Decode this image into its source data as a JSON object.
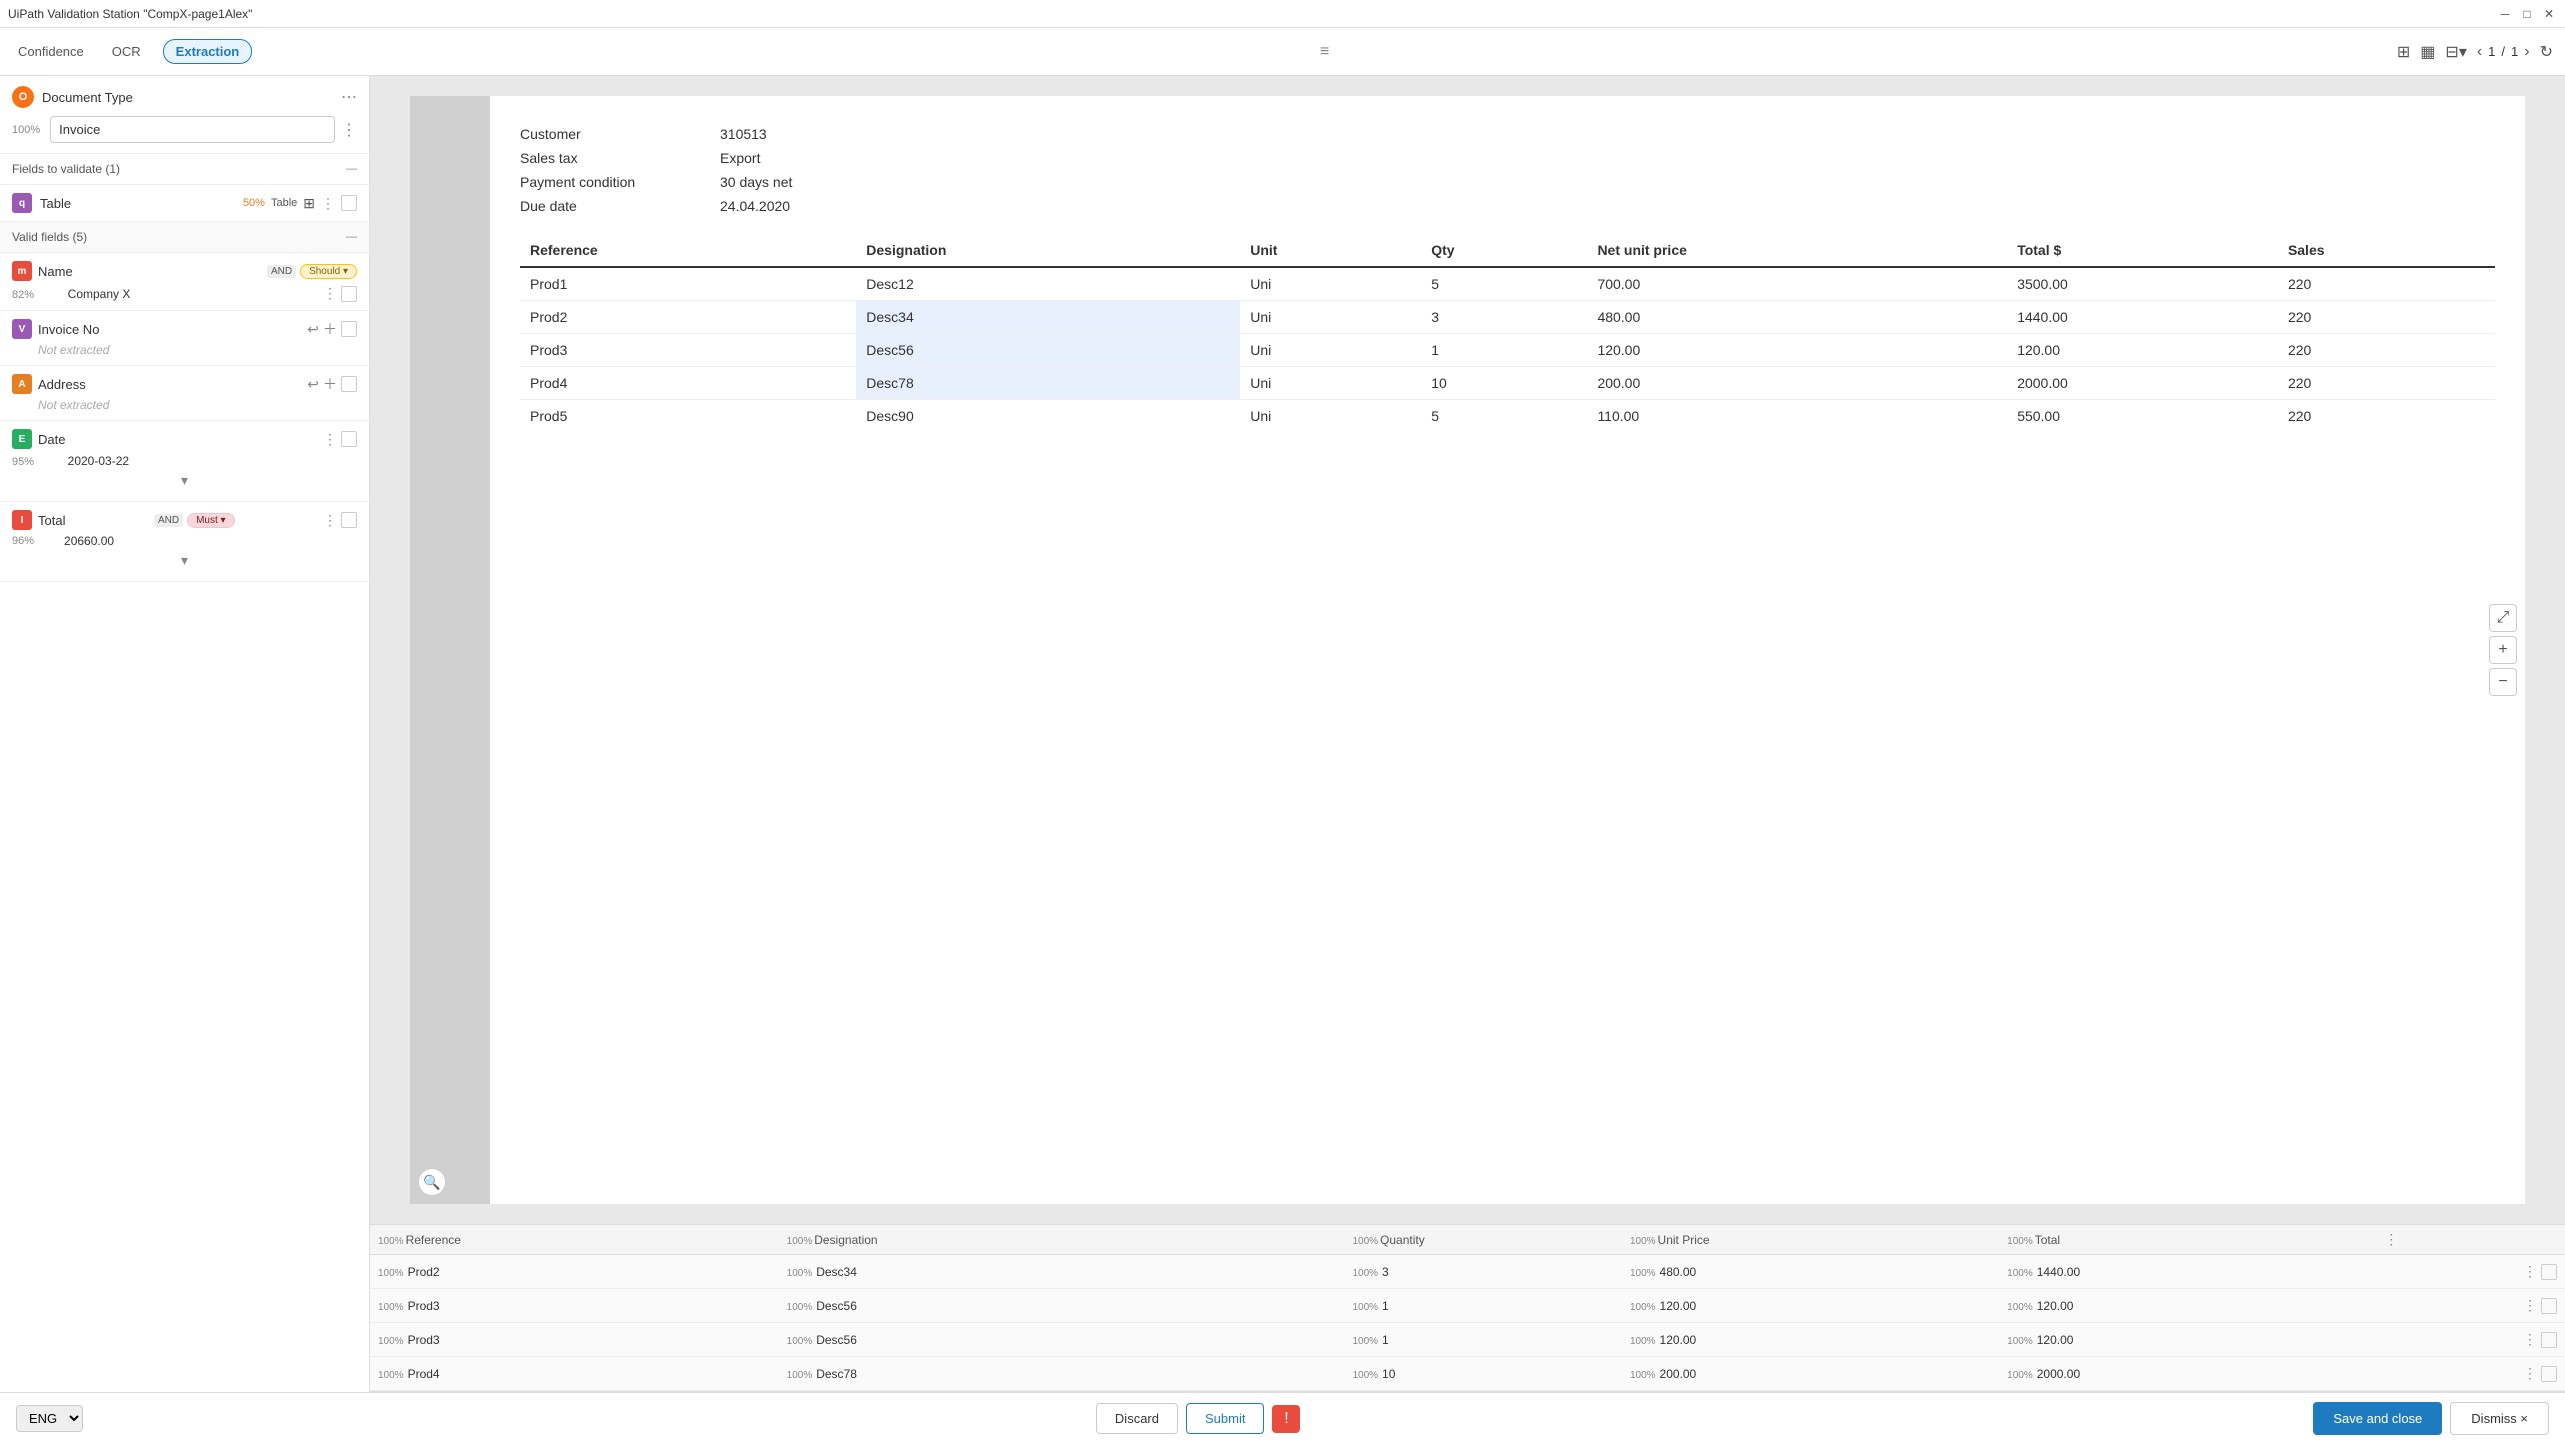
{
  "titleBar": {
    "title": "UiPath Validation Station \"CompX-page1Alex\"",
    "controls": [
      "minimize",
      "maximize",
      "close"
    ]
  },
  "topNav": {
    "confidence": "Confidence",
    "ocr": "OCR",
    "extraction": "Extraction",
    "activeTab": "Extraction",
    "filterIcon": "≡",
    "viewIcons": [
      "grid",
      "layout",
      "layout2"
    ],
    "page": {
      "current": "1",
      "total": "1"
    },
    "refreshIcon": "↻"
  },
  "leftPanel": {
    "documentType": {
      "icon": "O",
      "label": "Document Type",
      "confidence": "100%",
      "options": [
        "Invoice"
      ],
      "selectedOption": "Invoice"
    },
    "fieldsToValidate": {
      "label": "Fields to validate (1)",
      "collapse": "—",
      "tableField": {
        "icon": "q",
        "name": "Table",
        "confidence": "50%",
        "label": "Table"
      }
    },
    "validFields": {
      "label": "Valid fields (5)",
      "collapse": "—",
      "fields": [
        {
          "id": "name",
          "icon": "m",
          "iconColor": "#e74c3c",
          "label": "Name",
          "andBadge": "AND",
          "condBadge": "Should",
          "condColor": "should",
          "confidence": "82%",
          "value": "Company X",
          "hasMore": true,
          "hasCheckbox": true
        },
        {
          "id": "invoice-no",
          "icon": "V",
          "iconColor": "#9b59b6",
          "label": "Invoice No",
          "confidence": null,
          "value": null,
          "notExtracted": true,
          "hasActions": true,
          "hasCheckbox": true
        },
        {
          "id": "address",
          "icon": "A",
          "iconColor": "#e67e22",
          "label": "Address",
          "confidence": null,
          "value": null,
          "notExtracted": true,
          "hasActions": true,
          "hasCheckbox": true
        },
        {
          "id": "date",
          "icon": "E",
          "iconColor": "#27ae60",
          "label": "Date",
          "confidence": "95%",
          "value": "2020-03-22",
          "hasMore": true,
          "hasCheckbox": true,
          "hasChevron": true
        },
        {
          "id": "total",
          "icon": "I",
          "iconColor": "#e74c3c",
          "label": "Total",
          "andBadge": "AND",
          "condBadge": "Must",
          "condColor": "must",
          "confidence": "96%",
          "value": "20660.00",
          "hasMore": true,
          "hasCheckbox": true,
          "hasChevron": true
        }
      ]
    }
  },
  "document": {
    "fields": [
      {
        "label": "Customer",
        "value": "310513"
      },
      {
        "label": "Sales tax",
        "value": "Export"
      },
      {
        "label": "Payment condition",
        "value": "30 days net"
      },
      {
        "label": "Due date",
        "value": "24.04.2020"
      }
    ],
    "table": {
      "headers": [
        "Reference",
        "Designation",
        "Unit",
        "Qty",
        "Net unit price",
        "Total $",
        "Sales"
      ],
      "rows": [
        [
          "Prod1",
          "Desc12",
          "Uni",
          "5",
          "700.00",
          "3500.00",
          "220"
        ],
        [
          "Prod2",
          "Desc34",
          "Uni",
          "3",
          "480.00",
          "1440.00",
          "220"
        ],
        [
          "Prod3",
          "Desc56",
          "Uni",
          "1",
          "120.00",
          "120.00",
          "220"
        ],
        [
          "Prod4",
          "Desc78",
          "Uni",
          "10",
          "200.00",
          "2000.00",
          "220"
        ],
        [
          "Prod5",
          "Desc90",
          "Uni",
          "5",
          "110.00",
          "550.00",
          "220"
        ]
      ]
    }
  },
  "extractionPanel": {
    "columns": [
      {
        "conf": "100%",
        "name": "Reference"
      },
      {
        "conf": "100%",
        "name": "Designation"
      },
      {
        "conf": "100%",
        "name": "Quantity"
      },
      {
        "conf": "100%",
        "name": "Unit Price"
      },
      {
        "conf": "100%",
        "name": "Total"
      }
    ],
    "rows": [
      {
        "refConf": "100%",
        "ref": "Prod2",
        "desConf": "100%",
        "des": "Desc34",
        "qtyConf": "100%",
        "qty": "3",
        "upConf": "100%",
        "up": "480.00",
        "totConf": "100%",
        "tot": "1440.00"
      },
      {
        "refConf": "100%",
        "ref": "Prod3",
        "desConf": "100%",
        "des": "Desc56",
        "qtyConf": "100%",
        "qty": "1",
        "upConf": "100%",
        "up": "120.00",
        "totConf": "100%",
        "tot": "120.00"
      },
      {
        "refConf": "100%",
        "ref": "Prod3",
        "desConf": "100%",
        "des": "Desc56",
        "qtyConf": "100%",
        "qty": "1",
        "upConf": "100%",
        "up": "120.00",
        "totConf": "100%",
        "tot": "120.00"
      },
      {
        "refConf": "100%",
        "ref": "Prod4",
        "desConf": "100%",
        "des": "Desc78",
        "qtyConf": "100%",
        "qty": "10",
        "upConf": "100%",
        "up": "200.00",
        "totConf": "100%",
        "tot": "2000.00"
      }
    ]
  },
  "bottomBar": {
    "language": "ENG",
    "discard": "Discard",
    "submit": "Submit",
    "saveAndClose": "Save and close",
    "dismiss": "Dismiss ×"
  }
}
